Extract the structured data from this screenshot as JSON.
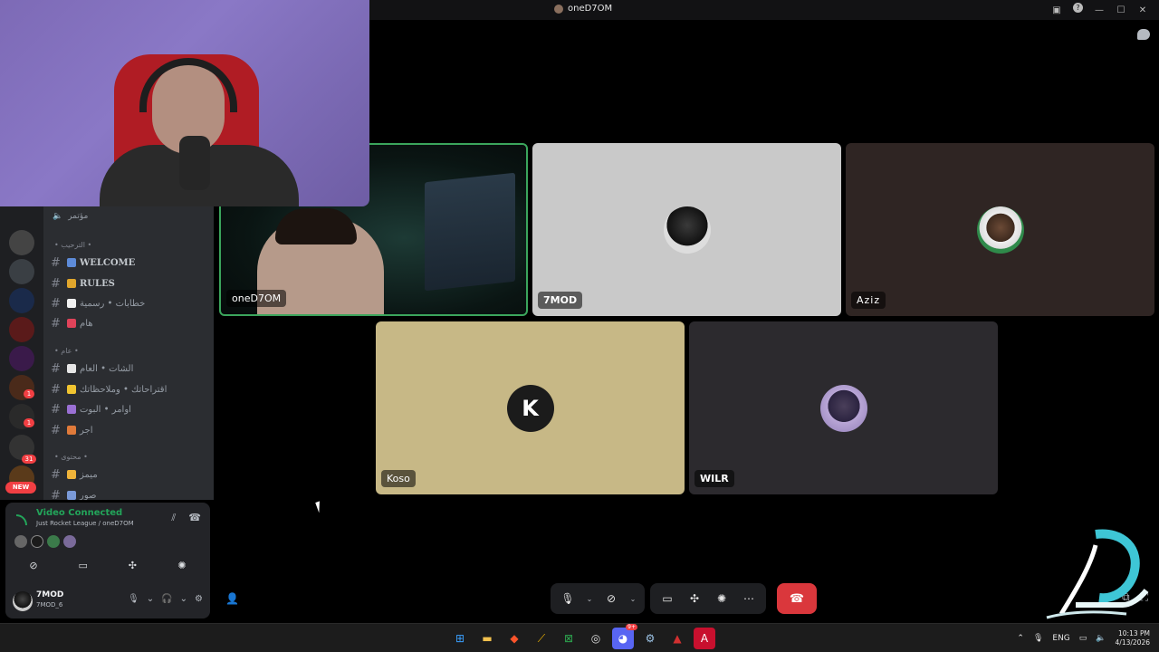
{
  "window": {
    "title": "oneD7OM",
    "colors": {
      "background": "#000000",
      "speaking_border": "#3ba55c",
      "hangup": "#da373c",
      "connected": "#23a55a"
    }
  },
  "sidebar": {
    "voice_channel": "مؤتمر",
    "categories": [
      {
        "label": "الترحيب",
        "channels": [
          {
            "label": "WELCOME",
            "emoji_color": "#5d8bd8",
            "bold": true
          },
          {
            "label": "RULES",
            "emoji_color": "#e0a62c",
            "bold": true
          },
          {
            "label": "خطابات • رسمية",
            "emoji_color": "#f1f1f1",
            "bold": false
          },
          {
            "label": "هام",
            "emoji_color": "#e0435a",
            "bold": false
          }
        ]
      },
      {
        "label": "عام",
        "channels": [
          {
            "label": "الشات • العام",
            "emoji_color": "#e6e6e6",
            "bold": false
          },
          {
            "label": "اقتراحاتك • وملاحظاتك",
            "emoji_color": "#f0c430",
            "bold": false
          },
          {
            "label": "اوامر • البوت",
            "emoji_color": "#9a70d4",
            "bold": false
          },
          {
            "label": "اجر",
            "emoji_color": "#e07a3a",
            "bold": false
          }
        ]
      },
      {
        "label": "محتوى",
        "channels": [
          {
            "label": "ميمز",
            "emoji_color": "#f0b43a",
            "bold": false
          },
          {
            "label": "صور",
            "emoji_color": "#7a9ad8",
            "bold": false
          }
        ]
      }
    ],
    "server_badges": [
      "1",
      "1",
      "31"
    ],
    "new_badge": "NEW"
  },
  "voice_panel": {
    "status": "Video Connected",
    "location": "Just Rocket League / oneD7OM",
    "user_name": "7MOD",
    "user_tag": "7MOD_6"
  },
  "participants": [
    {
      "name": "oneD7OM",
      "type": "video"
    },
    {
      "name": "7MOD",
      "type": "avatar"
    },
    {
      "name": "Aziz",
      "type": "avatar"
    },
    {
      "name": "Koso",
      "type": "avatar"
    },
    {
      "name": "WILR",
      "type": "avatar"
    }
  ],
  "icons": {
    "mic": "mic-icon",
    "camera": "camera-off-icon",
    "screen": "screen-share-icon",
    "activities": "activities-icon",
    "soundboard": "soundboard-icon",
    "more": "more-icon",
    "hangup": "phone-hangup-icon"
  },
  "taskbar": {
    "language": "ENG",
    "time": "10:13 PM",
    "date": "4/13/2026",
    "notification_badge": "9+"
  }
}
